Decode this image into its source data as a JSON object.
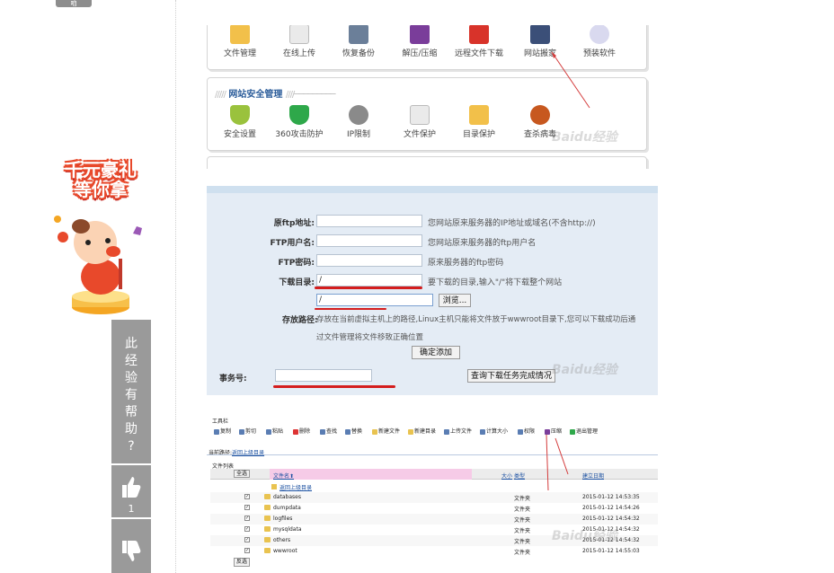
{
  "left_tab": {
    "label": "咱"
  },
  "promo": {
    "line1": "千元豪礼",
    "line2": "等你拿"
  },
  "feedback": {
    "question_chars": [
      "此",
      "经",
      "验",
      "有",
      "帮",
      "助",
      "?"
    ],
    "like_count": "1"
  },
  "shot1": {
    "row1": [
      "文件管理",
      "在线上传",
      "恢复备份",
      "解压/压缩",
      "远程文件下载",
      "网站搬家",
      "预装软件"
    ],
    "group2_title": "网站安全管理",
    "row2": [
      "安全设置",
      "360攻击防护",
      "IP限制",
      "文件保护",
      "目录保护",
      "查杀病毒"
    ]
  },
  "shot2": {
    "fields": [
      {
        "label": "原ftp地址:",
        "value": "",
        "hint": "您网站原来服务器的IP地址或域名(不含http://)"
      },
      {
        "label": "FTP用户名:",
        "value": "",
        "hint": "您网站原来服务器的ftp用户名"
      },
      {
        "label": "FTP密码:",
        "value": "",
        "hint": "原来服务器的ftp密码"
      },
      {
        "label": "下载目录:",
        "value": "/",
        "hint": "要下载的目录,输入\"/\"将下载整个网站"
      }
    ],
    "browse_value": "/",
    "browse_label": "浏览...",
    "store_label": "存放路径:",
    "store_hint1": "存放在当前虚拟主机上的路径,Linux主机只能将文件放于wwwroot目录下,您可以下载成功后通",
    "store_hint2": "过文件管理将文件移致正确位置",
    "confirm_label": "确定添加",
    "task_label": "事务号:",
    "task_value": "",
    "query_label": "查询下载任务完成情况"
  },
  "shot3": {
    "toolbar_title": "工具栏",
    "toolbar": [
      "复制",
      "剪切",
      "粘贴",
      "删除",
      "查找",
      "替换",
      "新建文件",
      "新建目录",
      "上传文件",
      "计算大小",
      "权限",
      "压缩",
      "退出管理"
    ],
    "current_path_label": "当前路径:",
    "back_link": "返回上级目录",
    "list_title": "文件列表",
    "select_all": "全选",
    "invert_select": "反选",
    "columns": {
      "name": "文件名",
      "size": "大小",
      "type": "类型",
      "date": "建立日期"
    },
    "rows": [
      {
        "name": "databases",
        "type": "文件夹",
        "date": "2015-01-12 14:53:35"
      },
      {
        "name": "dumpdata",
        "type": "文件夹",
        "date": "2015-01-12 14:54:26"
      },
      {
        "name": "logfiles",
        "type": "文件夹",
        "date": "2015-01-12 14:54:32"
      },
      {
        "name": "mysqldata",
        "type": "文件夹",
        "date": "2015-01-12 14:54:32"
      },
      {
        "name": "others",
        "type": "文件夹",
        "date": "2015-01-12 14:54:32"
      },
      {
        "name": "wwwroot",
        "type": "文件夹",
        "date": "2015-01-12 14:55:03"
      }
    ]
  },
  "watermark": "Baidu经验"
}
